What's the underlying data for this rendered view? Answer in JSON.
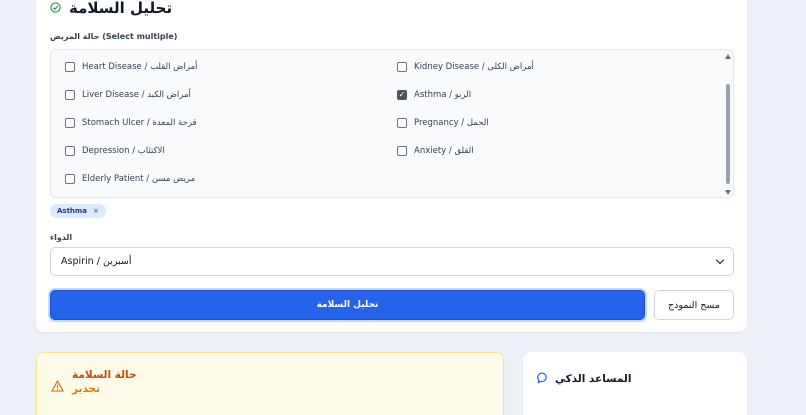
{
  "form": {
    "title": "تحليل السلامة",
    "conditions_label": "حالة المريض (Select multiple)",
    "conditions": [
      {
        "label": "Heart Disease / أمراض القلب",
        "checked": false
      },
      {
        "label": "Kidney Disease / أمراض الكلى",
        "checked": false
      },
      {
        "label": "Liver Disease / أمراض الكبد",
        "checked": false
      },
      {
        "label": "Asthma / الربو",
        "checked": true
      },
      {
        "label": "Stomach Ulcer / قرحة المعدة",
        "checked": false
      },
      {
        "label": "Pregnancy / الحمل",
        "checked": false
      },
      {
        "label": "Depression / الاكتئاب",
        "checked": false
      },
      {
        "label": "Anxiety / القلق",
        "checked": false
      },
      {
        "label": "Elderly Patient / مريض مسن",
        "checked": false
      }
    ],
    "selected_chips": [
      {
        "label": "Asthma",
        "remove": "×"
      }
    ],
    "drug_label": "الدواء",
    "drug_selected": "Aspirin / أسبرين",
    "analyze_button": "تحليل السلامة",
    "clear_button": "مسح النموذج"
  },
  "status": {
    "title": "حالة السلامة",
    "level": "تحذير"
  },
  "assistant": {
    "title": "المساعد الذكي"
  },
  "colors": {
    "primary": "#2563eb",
    "warning": "#d97706",
    "warning_bg": "#fefce8",
    "success": "#16a34a",
    "page_bg": "#eef0f8"
  },
  "icons": {
    "title": "check-circle-icon",
    "status": "warning-triangle-icon",
    "assistant": "chat-bubble-icon",
    "select": "chevron-down-icon"
  }
}
